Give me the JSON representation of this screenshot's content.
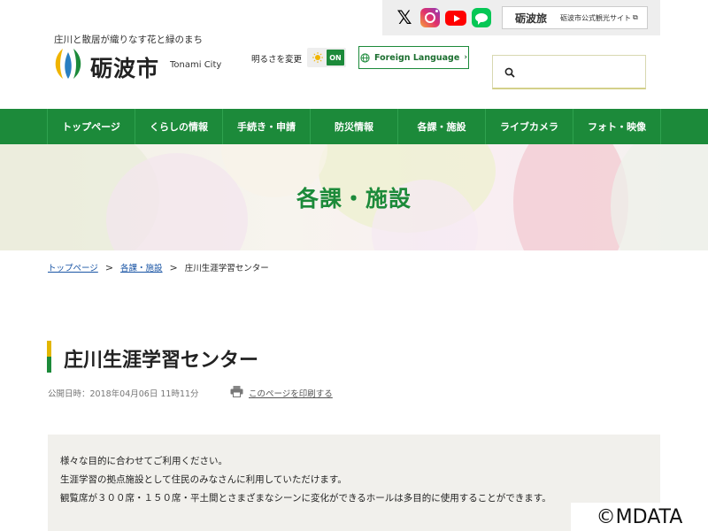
{
  "colors": {
    "brand_green": "#1c8a3a",
    "accent_yellow": "#e2b600",
    "link_blue": "#1a55a5"
  },
  "sns": {
    "x": {
      "icon": "x-icon",
      "label": "𝕏"
    },
    "instagram": {
      "icon": "instagram-icon"
    },
    "youtube": {
      "icon": "youtube-icon"
    },
    "line": {
      "icon": "line-icon"
    }
  },
  "tourism": {
    "logo_text": "砺波旅",
    "label": "砺波市公式観光サイト"
  },
  "header": {
    "tagline": "庄川と散居が織りなす花と緑のまち",
    "city_name_jp": "砺波市",
    "city_name_en": "Tonami City"
  },
  "brightness": {
    "label": "明るさを変更",
    "state": "ON"
  },
  "foreign": {
    "label": "Foreign Language"
  },
  "search": {
    "placeholder": ""
  },
  "nav": {
    "items": [
      {
        "label": "トップページ"
      },
      {
        "label": "くらしの情報"
      },
      {
        "label": "手続き・申請"
      },
      {
        "label": "防災情報"
      },
      {
        "label": "各課・施設"
      },
      {
        "label": "ライブカメラ"
      },
      {
        "label": "フォト・映像"
      }
    ]
  },
  "hero": {
    "title": "各課・施設"
  },
  "breadcrumb": {
    "items": [
      {
        "label": "トップページ"
      },
      {
        "label": "各課・施設"
      }
    ],
    "current": "庄川生涯学習センター"
  },
  "page": {
    "title": "庄川生涯学習センター",
    "published": "公開日時：2018年04月06日 11時11分",
    "print_label": "このページを印刷する"
  },
  "content": {
    "lines": [
      "様々な目的に合わせてご利用ください。",
      "生涯学習の拠点施設として住民のみなさんに利用していただけます。",
      "観覧席が３００席・１５０席・平土間とさまざまなシーンに変化ができるホールは多目的に使用することができます。"
    ]
  },
  "watermark": "©MDATA"
}
